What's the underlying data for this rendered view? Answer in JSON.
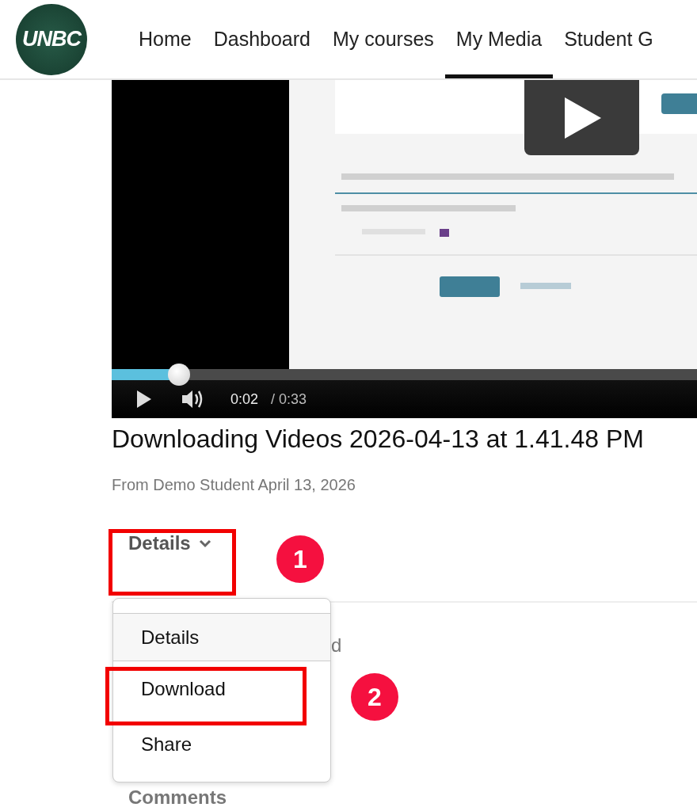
{
  "header": {
    "logo": "UNBC",
    "nav": [
      {
        "label": "Home",
        "selected": false
      },
      {
        "label": "Dashboard",
        "selected": false
      },
      {
        "label": "My courses",
        "selected": false
      },
      {
        "label": "My Media",
        "selected": true
      },
      {
        "label": "Student G",
        "selected": false
      }
    ]
  },
  "player": {
    "kind": "picture",
    "progress": {
      "level": 0.115
    },
    "current_time": "0:02",
    "duration": "/ 0:33"
  },
  "media": {
    "title": "Downloading Videos 2026-04-13 at 1.41.48 PM",
    "byline": "From Demo Student April 13, 2026"
  },
  "actions_menu": {
    "label": "Details",
    "expanded": true,
    "items": [
      {
        "label": "Details",
        "selected": true
      },
      {
        "label": "Download",
        "selected": false
      },
      {
        "label": "Share",
        "selected": false
      }
    ]
  },
  "hidden_tab_fragment": "d",
  "comments_heading": "Comments",
  "annotations": [
    {
      "number": "1"
    },
    {
      "number": "2"
    }
  ]
}
